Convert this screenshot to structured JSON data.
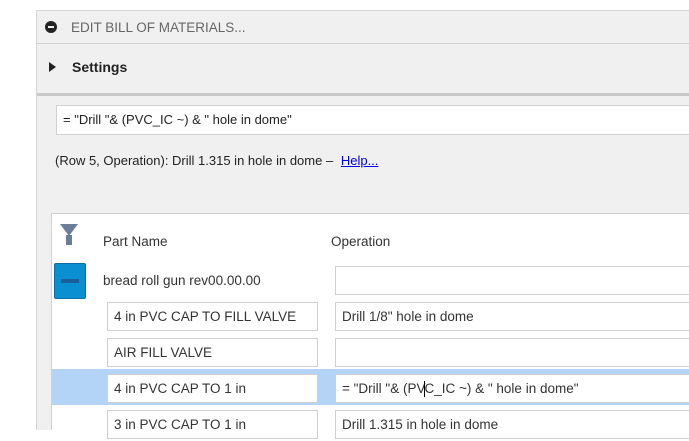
{
  "header": {
    "title": "EDIT BILL OF MATERIALS..."
  },
  "settings": {
    "label": "Settings"
  },
  "formula": {
    "value": "= \"Drill \"&  (PVC_IC  ~) & \" hole in dome\""
  },
  "status": {
    "text": "(Row 5, Operation): Drill 1.315 in hole in dome  –",
    "help_link": "Help..."
  },
  "table": {
    "columns": [
      "Part Name",
      "Operation"
    ],
    "root": {
      "part": "bread roll gun rev00.00.00",
      "operation": ""
    },
    "rows": [
      {
        "part": "4 in PVC CAP TO FILL VALVE",
        "operation": "Drill 1/8\" hole in dome"
      },
      {
        "part": "AIR FILL VALVE",
        "operation": ""
      },
      {
        "part": "4 in PVC CAP TO 1 in",
        "operation_before_caret": "= \"Drill \"&  (PV",
        "operation_after_caret": "C_IC  ~) & \" hole in dome\""
      },
      {
        "part": "3 in PVC CAP TO 1 in",
        "operation": "Drill 1.315 in hole in dome"
      }
    ]
  },
  "colors": {
    "selected_row": "#b3d4f7",
    "collapse_button": "#0a8fd1",
    "link": "#0000ee"
  }
}
